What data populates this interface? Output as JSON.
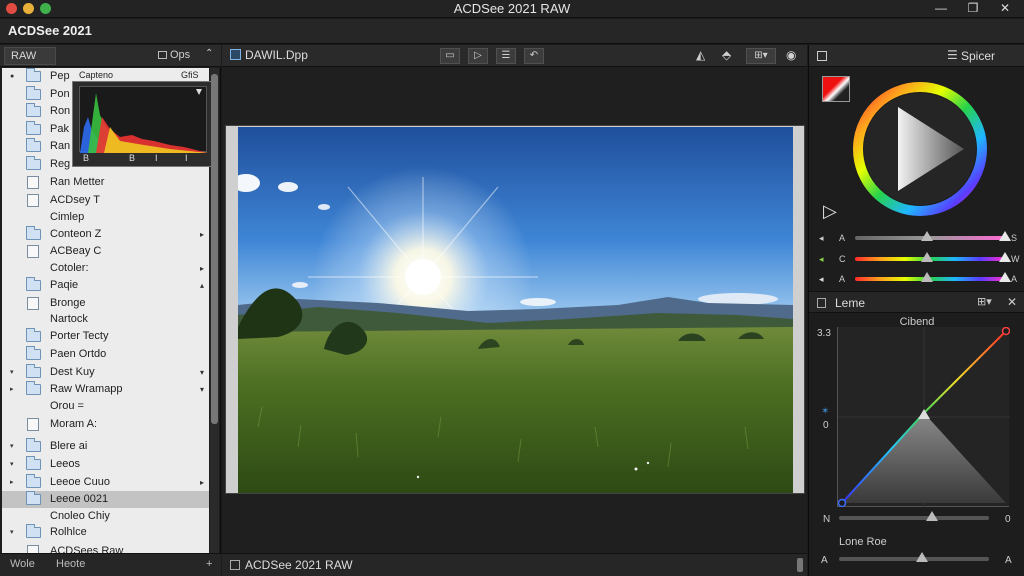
{
  "window": {
    "title": "ACDSee 2021 RAW",
    "app_name": "ACDSee 2021",
    "minimize": "—",
    "maximize": "❐",
    "close": "✕"
  },
  "colors": {
    "close": "#e04b42",
    "minimize": "#e9b03a",
    "zoom": "#3fb04a",
    "folder_fill": "#cfe1f3",
    "accent_blue": "#3b82c4"
  },
  "left_panel": {
    "tab_label": "RAW",
    "options_label": "Ops",
    "collapse_icon": "chevron-up-icon",
    "tree": [
      {
        "label": "Pep",
        "expand": "●",
        "icon": "folder",
        "arrow": ""
      },
      {
        "label": "Pon",
        "expand": "",
        "icon": "folder",
        "arrow": ""
      },
      {
        "label": "Ron",
        "expand": "",
        "icon": "folder",
        "arrow": ""
      },
      {
        "label": "Pak",
        "expand": "",
        "icon": "folder",
        "arrow": ""
      },
      {
        "label": "Ran",
        "expand": "",
        "icon": "folder",
        "arrow": ""
      },
      {
        "label": "Reg",
        "expand": "",
        "icon": "folder",
        "arrow": ""
      },
      {
        "label": "Ran Metter",
        "expand": "",
        "icon": "doc",
        "arrow": ""
      },
      {
        "label": "ACDsey T",
        "expand": "",
        "icon": "doc",
        "arrow": ""
      },
      {
        "label": "Cimlep",
        "expand": "",
        "icon": "none",
        "arrow": ""
      },
      {
        "label": "Conteon Z",
        "expand": "",
        "icon": "folder",
        "arrow": "▸"
      },
      {
        "label": "ACBeay C",
        "expand": "",
        "icon": "doc",
        "arrow": ""
      },
      {
        "label": "Cotoler:",
        "expand": "",
        "icon": "none",
        "arrow": "▸"
      },
      {
        "label": "Paqie",
        "expand": "",
        "icon": "folder",
        "arrow": "▴"
      },
      {
        "label": "Bronge",
        "expand": "",
        "icon": "doc",
        "arrow": ""
      },
      {
        "label": "Nartock",
        "expand": "",
        "icon": "none",
        "arrow": ""
      },
      {
        "label": "Porter Tecty",
        "expand": "",
        "icon": "folder",
        "arrow": ""
      },
      {
        "label": "Paen Ortdo",
        "expand": "",
        "icon": "folder",
        "arrow": ""
      },
      {
        "label": "Dest Kuy",
        "expand": "▾",
        "icon": "folder",
        "arrow": "▾"
      },
      {
        "label": "Raw Wramapp",
        "expand": "▸",
        "icon": "folder",
        "arrow": "▾"
      },
      {
        "label": "Orou =",
        "expand": "",
        "icon": "none",
        "arrow": ""
      },
      {
        "label": "Moram A:",
        "expand": "",
        "icon": "doc",
        "arrow": ""
      },
      {
        "label": "Blere ai",
        "expand": "▾",
        "icon": "folder",
        "arrow": ""
      },
      {
        "label": "Leeos",
        "expand": "▾",
        "icon": "folder",
        "arrow": ""
      },
      {
        "label": "Leeoe Cuuo",
        "expand": "▸",
        "icon": "folder",
        "arrow": "▸"
      },
      {
        "label": "Leeoe 0021",
        "expand": "",
        "icon": "folder",
        "arrow": ""
      },
      {
        "label": "Cnoleo Chiy",
        "expand": "",
        "icon": "none",
        "arrow": ""
      },
      {
        "label": "Rolhlce",
        "expand": "▾",
        "icon": "folder",
        "arrow": ""
      },
      {
        "label": "ACDSees Raw",
        "expand": "",
        "icon": "doc",
        "arrow": ""
      }
    ],
    "histogram": {
      "header": "Capteno",
      "header_right": "GfiS",
      "tick_labels": [
        "B",
        "B",
        "I",
        "I"
      ]
    },
    "bottom": {
      "left": "Wole",
      "right": "Heote"
    }
  },
  "center": {
    "tab_title": "DAWIL.Dpp",
    "bottom_title": "ACDSee 2021 RAW",
    "toolbar_icons": [
      "folder-icon",
      "play-icon",
      "list-icon",
      "rotate-icon",
      "levels-icon",
      "stamp-icon",
      "layout-icon",
      "info-icon"
    ]
  },
  "right_panel": {
    "title": "Spicer",
    "sliders": [
      {
        "left": "A",
        "right": "S",
        "value": 0.48
      },
      {
        "left": "C",
        "right": "W",
        "value": 0.48
      },
      {
        "left": "A",
        "right": "A",
        "value": 0.48
      }
    ],
    "lens_title": "Leme",
    "curve_title": "Cibend",
    "curve_ymax": "3.3",
    "curve_ymid": "0",
    "curve_left": "N",
    "curve_right": "0",
    "lens_row_title": "Lone Roe",
    "bottom_left": "A",
    "bottom_right": "A",
    "curve_slider_value": 0.62,
    "bottom_slider_value": 0.55
  }
}
